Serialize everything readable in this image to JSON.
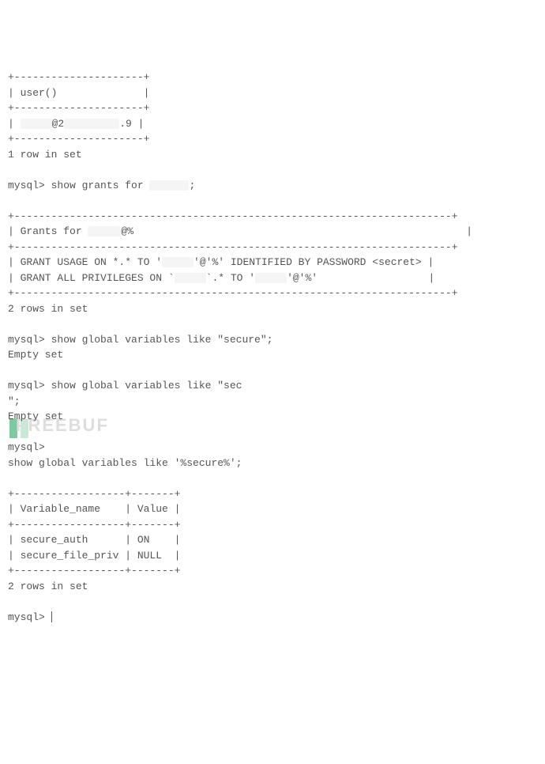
{
  "line1": "+---------------------+",
  "line2_pre": "| user()",
  "line2_suf": "              |",
  "line3": "+---------------------+",
  "line4_pre": "| ",
  "line4_mid": "@2",
  "line4_suf": ".9 |",
  "line5": "+---------------------+",
  "line6": "1 row in set",
  "line7_pre": "mysql> show grants for ",
  "line7_suf": ";",
  "line8": "+-----------------------------------------------------------------------+",
  "line9_pre": "| Grants for ",
  "line9_suf": "@%                                                      |",
  "line10": "+-----------------------------------------------------------------------+",
  "line11_pre": "| GRANT USAGE ON *.* TO '",
  "line11_mid": "'@'%' IDENTIFIED BY PASSWORD <secret> |",
  "line12_pre": "| GRANT ALL PRIVILEGES ON `",
  "line12_mid": "`.* TO '",
  "line12_suf": "'@'%'                  |",
  "line13": "+-----------------------------------------------------------------------+",
  "line14": "2 rows in set",
  "line15": "mysql> show global variables like \"secure\";",
  "line16": "Empty set",
  "line17": "mysql> show global variables like \"sec",
  "line18": "\";",
  "line19": "Empty set",
  "line20": "mysql>",
  "line21": "show global variables like '%secure%';",
  "line22": "+------------------+-------+",
  "line23": "| Variable_name    | Value |",
  "line24": "+------------------+-------+",
  "line25": "| secure_auth      | ON    |",
  "line26": "| secure_file_priv | NULL  |",
  "line27": "+------------------+-------+",
  "line28": "2 rows in set",
  "line29": "mysql> ",
  "watermark": "FREEBUF"
}
